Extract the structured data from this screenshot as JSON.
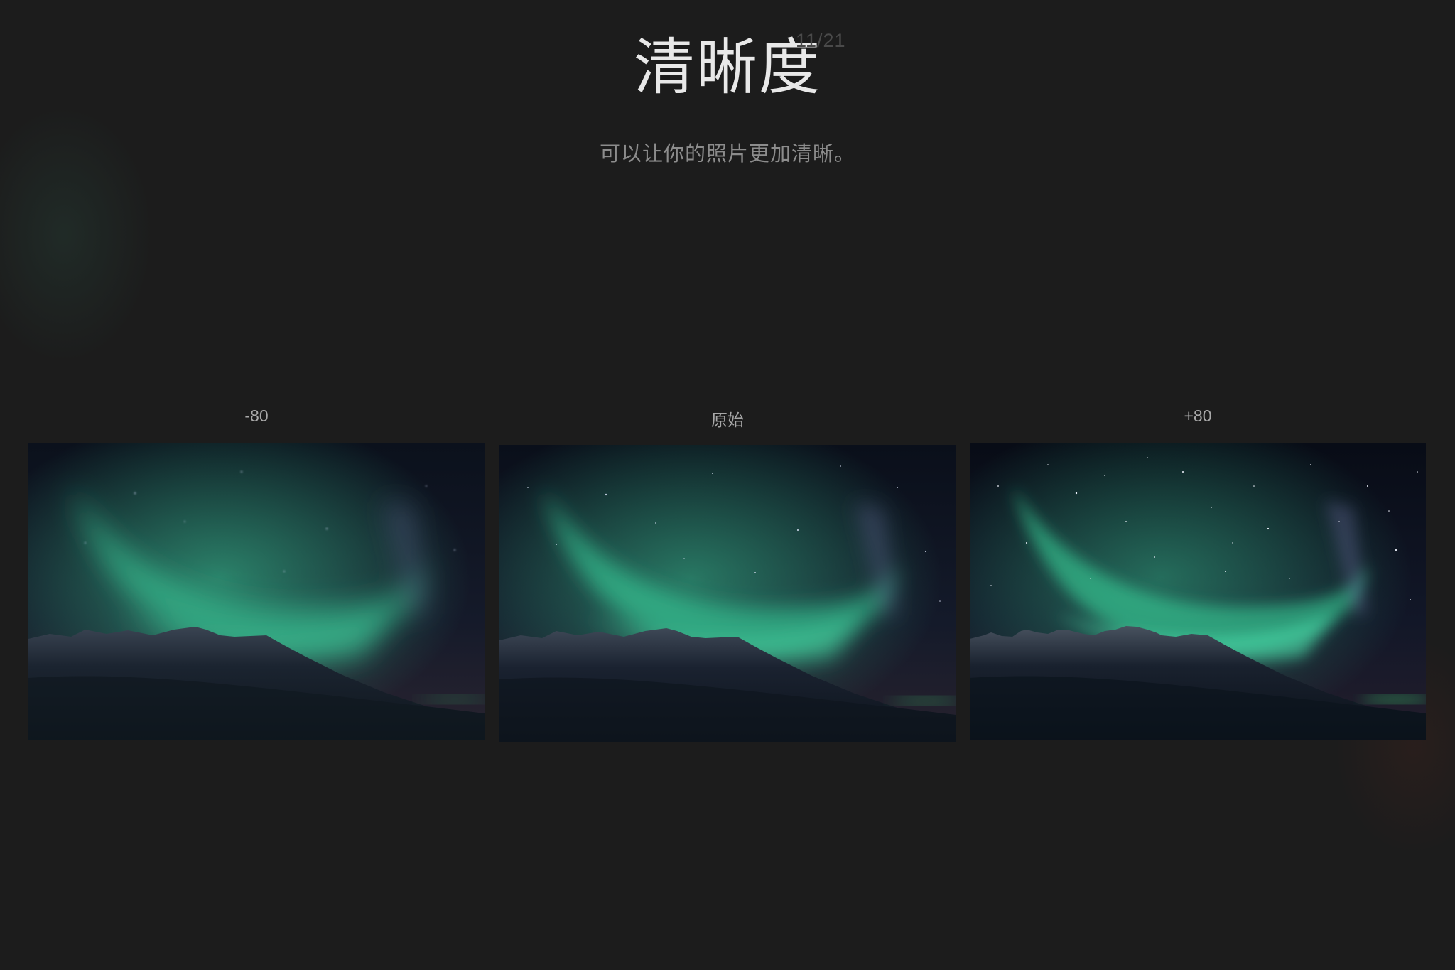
{
  "header": {
    "title": "清晰度",
    "counter": "11/21",
    "subtitle": "可以让你的照片更加清晰。"
  },
  "comparison": {
    "panels": [
      {
        "label": "-80"
      },
      {
        "label": "原始"
      },
      {
        "label": "+80"
      }
    ]
  },
  "colors": {
    "background": "#1c1c1c",
    "title": "#e8e8e8",
    "counter": "#4a4a4a",
    "subtitle": "#8c8c8c",
    "label": "#a8a8a8",
    "aurora": "#3fd8a0",
    "sky": "#0c1220"
  }
}
